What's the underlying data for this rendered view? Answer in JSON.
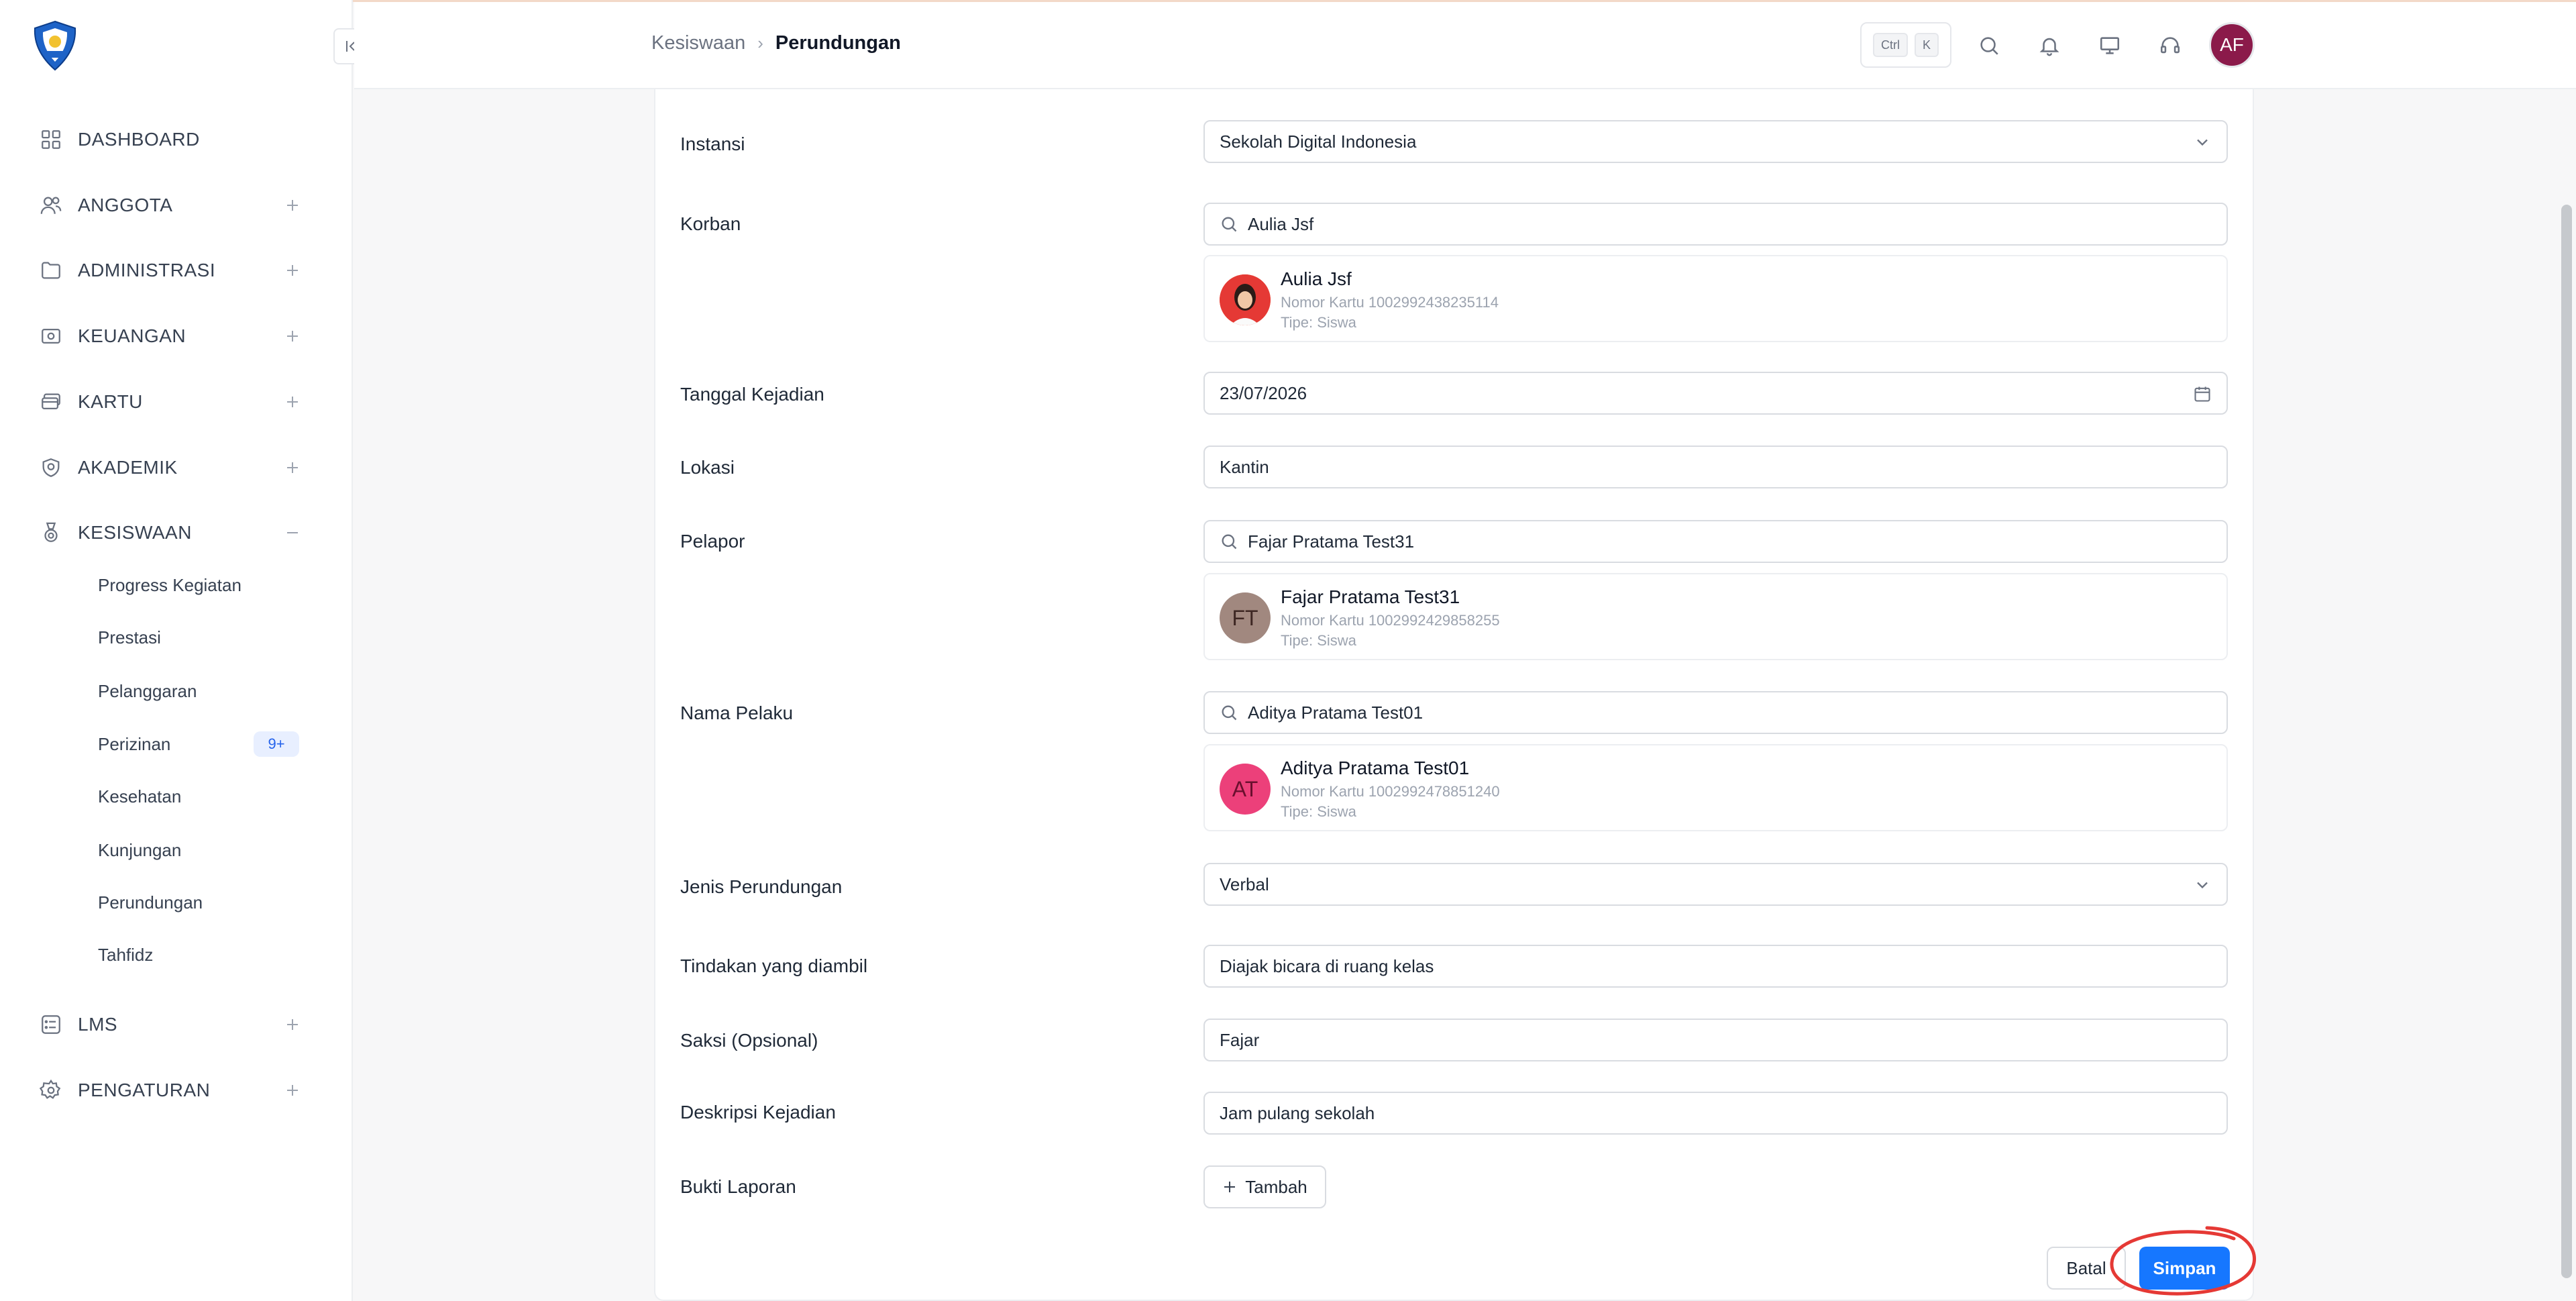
{
  "sidebar": {
    "nav": [
      {
        "label": "DASHBOARD",
        "icon": "dashboard-icon",
        "toggle": ""
      },
      {
        "label": "ANGGOTA",
        "icon": "users-icon",
        "toggle": "+"
      },
      {
        "label": "ADMINISTRASI",
        "icon": "folder-icon",
        "toggle": "+"
      },
      {
        "label": "KEUANGAN",
        "icon": "money-icon",
        "toggle": "+"
      },
      {
        "label": "KARTU",
        "icon": "card-icon",
        "toggle": "+"
      },
      {
        "label": "AKADEMIK",
        "icon": "academic-icon",
        "toggle": "+"
      },
      {
        "label": "KESISWAAN",
        "icon": "medal-icon",
        "toggle": "−"
      },
      {
        "label": "LMS",
        "icon": "list-icon",
        "toggle": "+"
      },
      {
        "label": "PENGATURAN",
        "icon": "gear-icon",
        "toggle": "+"
      }
    ],
    "sub_items": [
      "Progress Kegiatan",
      "Prestasi",
      "Pelanggaran",
      "Perizinan",
      "Kesehatan",
      "Kunjungan",
      "Perundungan",
      "Tahfidz"
    ],
    "perizinan_badge": "9+"
  },
  "header": {
    "breadcrumb_parent": "Kesiswaan",
    "breadcrumb_current": "Perundungan",
    "kbd_ctrl": "Ctrl",
    "kbd_k": "K",
    "avatar_initials": "AF"
  },
  "form": {
    "instansi_label": "Instansi",
    "instansi_value": "Sekolah Digital Indonesia",
    "korban_label": "Korban",
    "korban_search": "Aulia Jsf",
    "korban_card": {
      "name": "Aulia Jsf",
      "card_no": "Nomor Kartu 1002992438235114",
      "type": "Tipe: Siswa"
    },
    "tanggal_label": "Tanggal Kejadian",
    "tanggal_value": "23/07/2026",
    "lokasi_label": "Lokasi",
    "lokasi_value": "Kantin",
    "pelapor_label": "Pelapor",
    "pelapor_search": "Fajar Pratama Test31",
    "pelapor_card": {
      "initials": "FT",
      "name": "Fajar Pratama Test31",
      "card_no": "Nomor Kartu 1002992429858255",
      "type": "Tipe: Siswa"
    },
    "pelaku_label": "Nama Pelaku",
    "pelaku_search": "Aditya Pratama Test01",
    "pelaku_card": {
      "initials": "AT",
      "name": "Aditya Pratama Test01",
      "card_no": "Nomor Kartu 1002992478851240",
      "type": "Tipe: Siswa"
    },
    "jenis_label": "Jenis Perundungan",
    "jenis_value": "Verbal",
    "tindakan_label": "Tindakan yang diambil",
    "tindakan_value": "Diajak bicara di ruang kelas",
    "saksi_label": "Saksi (Opsional)",
    "saksi_value": "Fajar",
    "deskripsi_label": "Deskripsi Kejadian",
    "deskripsi_value": "Jam pulang sekolah",
    "bukti_label": "Bukti Laporan",
    "tambah_label": "Tambah",
    "batal_label": "Batal",
    "simpan_label": "Simpan"
  },
  "colors": {
    "primary": "#1677ff",
    "avatar_af": "#8b1a4a",
    "avatar_ft": "#a1887f",
    "avatar_at": "#ec407a",
    "highlight_circle": "#e53935"
  }
}
